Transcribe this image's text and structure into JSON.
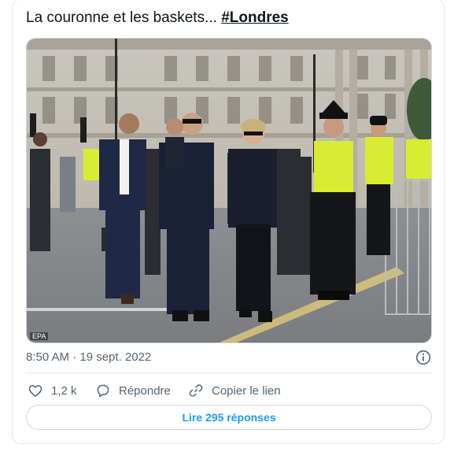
{
  "tweet": {
    "text": "La couronne et les baskets... ",
    "hashtag": "#Londres",
    "photo_credit": "EPA",
    "timestamp": "8:50 AM · 19 sept. 2022"
  },
  "actions": {
    "like_count": "1,2 k",
    "reply_label": "Répondre",
    "copy_label": "Copier le lien",
    "read_replies_label": "Lire 295 réponses"
  },
  "icons": {
    "like": "heart-icon",
    "reply": "speech-bubble-icon",
    "copy": "link-icon",
    "info": "info-icon"
  },
  "colors": {
    "accent": "#1d9bf0",
    "muted": "#536471",
    "border": "#cfd9de"
  }
}
